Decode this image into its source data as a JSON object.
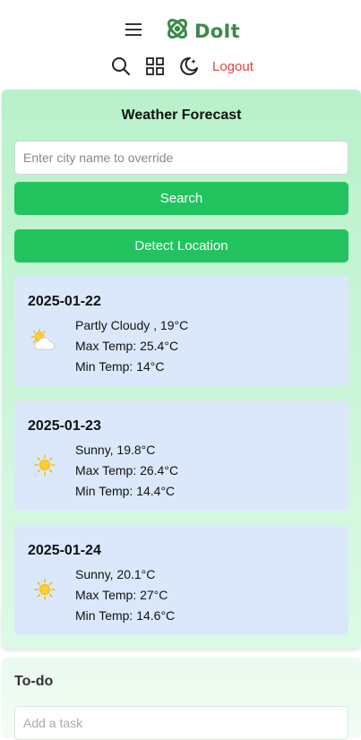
{
  "header": {
    "app_name": "DoIt",
    "logout_label": "Logout",
    "accent_color": "#3a8a4a",
    "logout_color": "#e0443c"
  },
  "weather": {
    "title": "Weather Forecast",
    "city_placeholder": "Enter city name to override",
    "search_label": "Search",
    "detect_label": "Detect Location",
    "button_color": "#22c35e",
    "days": [
      {
        "date": "2025-01-22",
        "icon": "partly-cloudy-icon",
        "summary": "Partly Cloudy , 19°C",
        "max": "Max Temp: 25.4°C",
        "min": "Min Temp: 14°C"
      },
      {
        "date": "2025-01-23",
        "icon": "sun-icon",
        "summary": "Sunny, 19.8°C",
        "max": "Max Temp: 26.4°C",
        "min": "Min Temp: 14.4°C"
      },
      {
        "date": "2025-01-24",
        "icon": "sun-icon",
        "summary": "Sunny, 20.1°C",
        "max": "Max Temp: 27°C",
        "min": "Min Temp: 14.6°C"
      }
    ]
  },
  "todo": {
    "title": "To-do",
    "task_placeholder": "Add a task"
  }
}
